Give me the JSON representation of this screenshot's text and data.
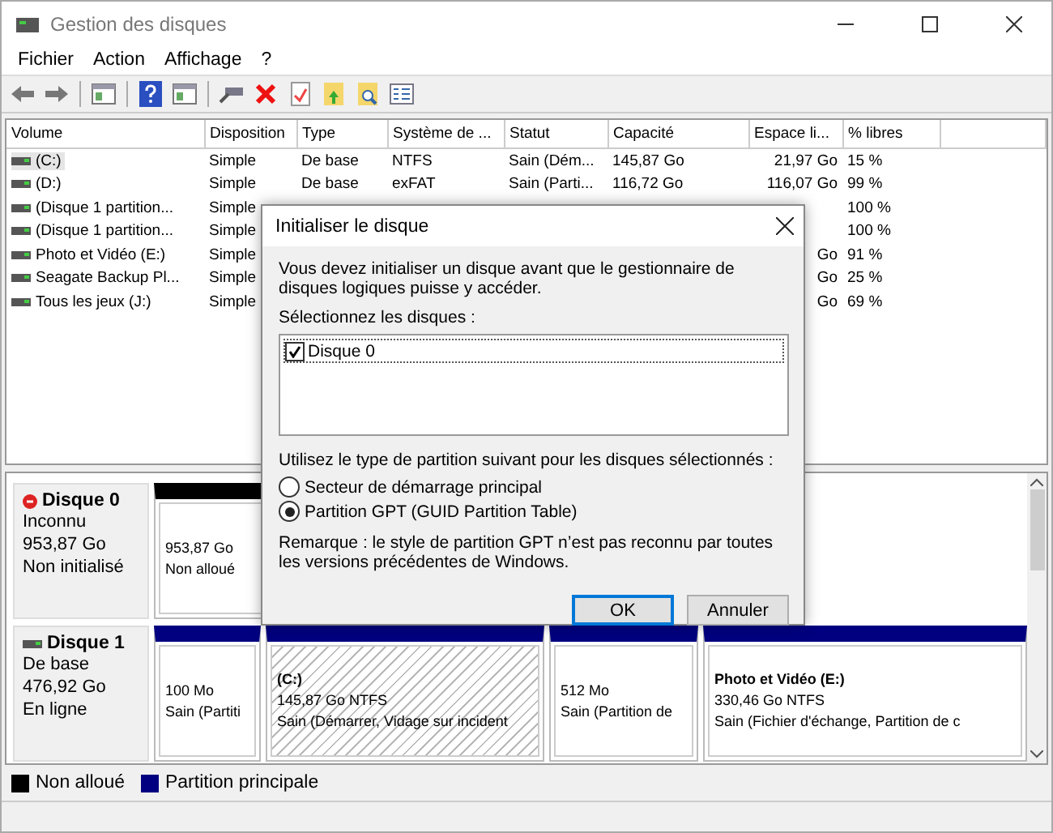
{
  "window": {
    "title": "Gestion des disques"
  },
  "menu": [
    "Fichier",
    "Action",
    "Affichage",
    "?"
  ],
  "table": {
    "columns": [
      "Volume",
      "Disposition",
      "Type",
      "Système de ...",
      "Statut",
      "Capacité",
      "Espace li...",
      "% libres"
    ],
    "rows": [
      {
        "volume": "(C:)",
        "layout": "Simple",
        "type": "De base",
        "fs": "NTFS",
        "status": "Sain (Dém...",
        "capacity": "145,87 Go",
        "free": "21,97 Go",
        "pct": "15 %",
        "selected": true
      },
      {
        "volume": "(D:)",
        "layout": "Simple",
        "type": "De base",
        "fs": "exFAT",
        "status": "Sain (Parti...",
        "capacity": "116,72 Go",
        "free": "116,07 Go",
        "pct": "99 %",
        "selected": false
      },
      {
        "volume": "(Disque 1 partition...",
        "layout": "Simple",
        "pct": "100 %",
        "selected": false
      },
      {
        "volume": "(Disque 1 partition...",
        "layout": "Simple",
        "pct": "100 %",
        "selected": false
      },
      {
        "volume": "Photo et Vidéo (E:)",
        "layout": "Simple",
        "free": "Go",
        "pct": "91 %",
        "selected": false
      },
      {
        "volume": "Seagate Backup Pl...",
        "layout": "Simple",
        "free": "Go",
        "pct": "25 %",
        "selected": false
      },
      {
        "volume": "Tous les jeux (J:)",
        "layout": "Simple",
        "free": "Go",
        "pct": "69 %",
        "selected": false
      }
    ]
  },
  "disks": [
    {
      "name": "Disque 0",
      "kind": "unknown",
      "type": "Inconnu",
      "size": "953,87 Go",
      "state": "Non initialisé",
      "partitions": [
        {
          "kind": "unallocated",
          "size": "953,87 Go",
          "status": "Non alloué",
          "selected": false
        }
      ]
    },
    {
      "name": "Disque 1",
      "kind": "basic",
      "type": "De base",
      "size": "476,92 Go",
      "state": "En ligne",
      "partitions": [
        {
          "kind": "primary",
          "size": "100 Mo",
          "status": "Sain (Partiti",
          "selected": false
        },
        {
          "kind": "primary",
          "label": "(C:)",
          "size": "145,87 Go NTFS",
          "status": "Sain (Démarrer, Vidage sur incident",
          "selected": true
        },
        {
          "kind": "primary",
          "size": "512 Mo",
          "status": "Sain (Partition de",
          "selected": false
        },
        {
          "kind": "primary",
          "label": "Photo et Vidéo  (E:)",
          "size": "330,46 Go NTFS",
          "status": "Sain (Fichier d'échange, Partition de c",
          "selected": false
        }
      ]
    }
  ],
  "legend": [
    {
      "label": "Non alloué",
      "color": "#000000"
    },
    {
      "label": "Partition principale",
      "color": "#000080"
    }
  ],
  "dialog": {
    "title": "Initialiser le disque",
    "message": "Vous devez initialiser un disque avant que le gestionnaire de disques logiques puisse y accéder.",
    "select_label": "Sélectionnez les disques :",
    "disks": [
      {
        "label": "Disque 0",
        "checked": true,
        "selected": true
      }
    ],
    "partition_prompt": "Utilisez le type de partition suivant pour les disques sélectionnés :",
    "options": [
      {
        "label": "Secteur de démarrage principal",
        "selected": false
      },
      {
        "label": "Partition GPT (GUID Partition Table)",
        "selected": true
      }
    ],
    "note": "Remarque : le style de partition GPT n’est pas reconnu par toutes les versions précédentes de Windows.",
    "buttons": [
      {
        "label": "OK",
        "default": true
      },
      {
        "label": "Annuler",
        "default": false
      }
    ]
  }
}
